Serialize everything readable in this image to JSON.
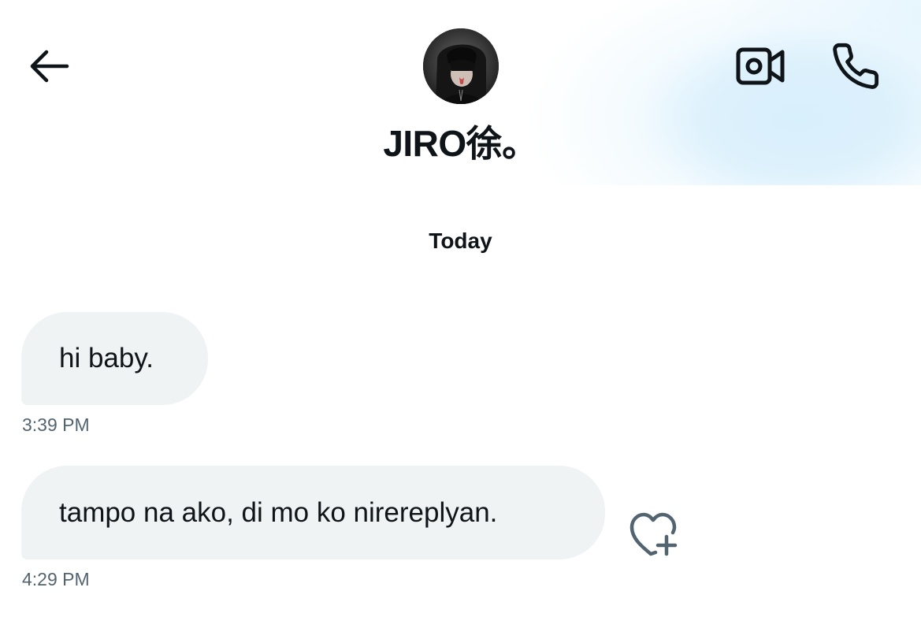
{
  "header": {
    "contact_name": "JIRO徐。",
    "back_icon": "arrow-left-icon",
    "video_icon": "video-call-icon",
    "phone_icon": "phone-icon"
  },
  "conversation": {
    "date_separator": "Today",
    "messages": [
      {
        "text": "hi baby.",
        "time": "3:39 PM"
      },
      {
        "text": "tampo na ako, di mo ko nirereplyan.",
        "time": "4:29 PM",
        "reaction_icon": "heart-add-icon"
      }
    ]
  },
  "colors": {
    "text_primary": "#0f1419",
    "text_secondary": "#536471",
    "bubble_bg": "#eff3f4",
    "header_gradient": "#d8effc"
  }
}
